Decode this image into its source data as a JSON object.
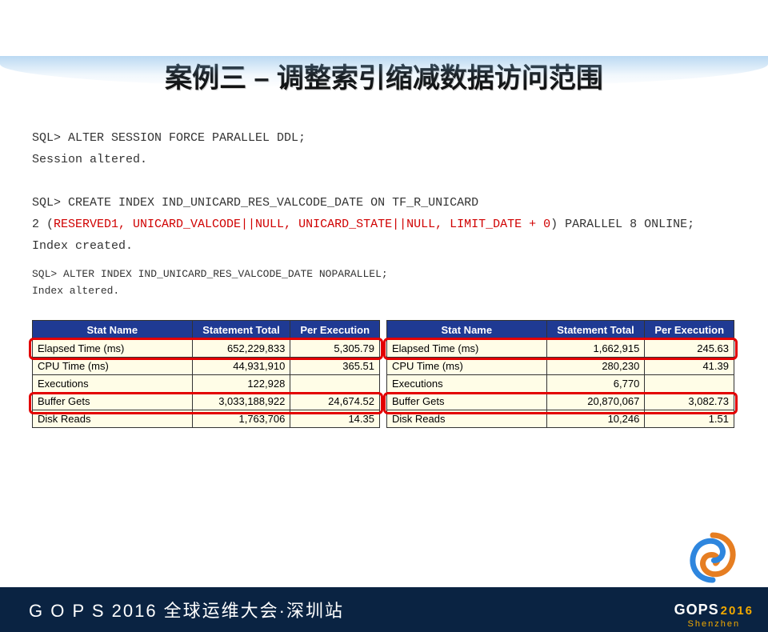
{
  "title": "案例三 – 调整索引缩减数据访问范围",
  "sql": {
    "line1": "SQL> ALTER SESSION FORCE PARALLEL DDL;",
    "line2": "Session altered.",
    "line3a": "SQL> CREATE INDEX IND_UNICARD_RES_VALCODE_DATE ON TF_R_UNICARD",
    "line3b_prefix": "  2  (",
    "line3b_red": "RESERVED1, UNICARD_VALCODE||NULL, UNICARD_STATE||NULL, LIMIT_DATE + 0",
    "line3b_suffix": ") PARALLEL 8 ONLINE;",
    "line4": "Index created.",
    "line5": "SQL> ALTER INDEX IND_UNICARD_RES_VALCODE_DATE NOPARALLEL;",
    "line6": "Index altered."
  },
  "table_headers": [
    "Stat Name",
    "Statement Total",
    "Per Execution"
  ],
  "chart_data": [
    {
      "type": "table",
      "title": "Before",
      "columns": [
        "Stat Name",
        "Statement Total",
        "Per Execution"
      ],
      "rows": [
        [
          "Elapsed Time (ms)",
          "652,229,833",
          "5,305.79"
        ],
        [
          "CPU Time (ms)",
          "44,931,910",
          "365.51"
        ],
        [
          "Executions",
          "122,928",
          ""
        ],
        [
          "Buffer Gets",
          "3,033,188,922",
          "24,674.52"
        ],
        [
          "Disk Reads",
          "1,763,706",
          "14.35"
        ]
      ],
      "highlight_rows": [
        0,
        3
      ]
    },
    {
      "type": "table",
      "title": "After",
      "columns": [
        "Stat Name",
        "Statement Total",
        "Per Execution"
      ],
      "rows": [
        [
          "Elapsed Time (ms)",
          "1,662,915",
          "245.63"
        ],
        [
          "CPU Time (ms)",
          "280,230",
          "41.39"
        ],
        [
          "Executions",
          "6,770",
          ""
        ],
        [
          "Buffer Gets",
          "20,870,067",
          "3,082.73"
        ],
        [
          "Disk Reads",
          "10,246",
          "1.51"
        ]
      ],
      "highlight_rows": [
        0,
        3
      ]
    }
  ],
  "footer": {
    "text": "G O P S 2016 全球运维大会·深圳站",
    "brand": "GOPS",
    "year": "2016",
    "loc": "Shenzhen"
  }
}
